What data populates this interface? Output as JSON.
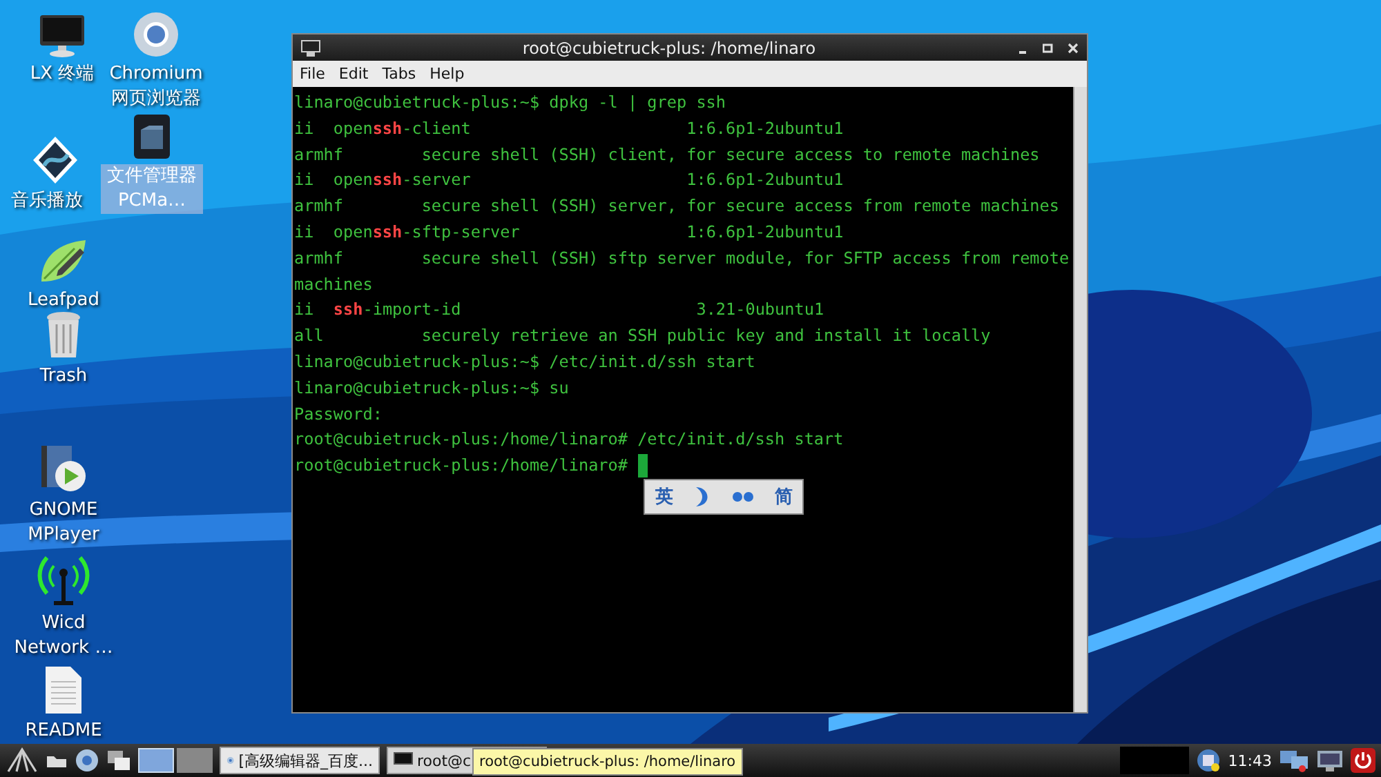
{
  "desktop_icons": [
    {
      "label": "LX 终端",
      "selected": false
    },
    {
      "label": "音乐播放",
      "selected": false
    },
    {
      "label": "Leafpad",
      "selected": false
    },
    {
      "label": "Trash",
      "selected": false
    },
    {
      "label": "GNOME MPlayer",
      "selected": false
    },
    {
      "label": "Wicd Network …",
      "selected": false
    },
    {
      "label": "README",
      "selected": false
    },
    {
      "label": "Chromium 网页浏览器",
      "selected": false
    },
    {
      "label": "文件管理器 PCMa…",
      "selected": true
    }
  ],
  "window": {
    "title": "root@cubietruck-plus: /home/linaro",
    "menu": [
      "File",
      "Edit",
      "Tabs",
      "Help"
    ],
    "lines": [
      [
        {
          "text": "linaro@cubietruck-plus:~$ dpkg -l | grep ssh",
          "match": false
        }
      ],
      [
        {
          "text": "ii  open",
          "match": false
        },
        {
          "text": "ssh",
          "match": true
        },
        {
          "text": "-client                      1:6.6p1-2ubuntu1",
          "match": false
        }
      ],
      [
        {
          "text": "armhf        secure shell (SSH) client, for secure access to remote machines",
          "match": false
        }
      ],
      [
        {
          "text": "ii  open",
          "match": false
        },
        {
          "text": "ssh",
          "match": true
        },
        {
          "text": "-server                      1:6.6p1-2ubuntu1",
          "match": false
        }
      ],
      [
        {
          "text": "armhf        secure shell (SSH) server, for secure access from remote machines",
          "match": false
        }
      ],
      [
        {
          "text": "ii  open",
          "match": false
        },
        {
          "text": "ssh",
          "match": true
        },
        {
          "text": "-sftp-server                 1:6.6p1-2ubuntu1",
          "match": false
        }
      ],
      [
        {
          "text": "armhf        secure shell (SSH) sftp server module, for SFTP access from remote",
          "match": false
        }
      ],
      [
        {
          "text": "machines",
          "match": false
        }
      ],
      [
        {
          "text": "ii  ",
          "match": false
        },
        {
          "text": "ssh",
          "match": true
        },
        {
          "text": "-import-id                        3.21-0ubuntu1",
          "match": false
        }
      ],
      [
        {
          "text": "all          securely retrieve an SSH public key and install it locally",
          "match": false
        }
      ],
      [
        {
          "text": "linaro@cubietruck-plus:~$ /etc/init.d/ssh start",
          "match": false
        }
      ],
      [
        {
          "text": "linaro@cubietruck-plus:~$ su",
          "match": false
        }
      ],
      [
        {
          "text": "Password:",
          "match": false
        }
      ],
      [
        {
          "text": "root@cubietruck-plus:/home/linaro# /etc/init.d/ssh start",
          "match": false
        }
      ],
      [
        {
          "text": "root@cubietruck-plus:/home/linaro# ",
          "match": false
        }
      ]
    ]
  },
  "input_method_bar": {
    "language": "英",
    "script": "简"
  },
  "taskbar": {
    "workspaces": [
      {
        "selected": true
      },
      {
        "selected": false
      }
    ],
    "tasks": [
      {
        "label": "[高级编辑器_百度..."
      },
      {
        "label": "root@c"
      }
    ],
    "tooltip": "root@cubietruck-plus: /home/linaro",
    "clock": "11:43"
  }
}
